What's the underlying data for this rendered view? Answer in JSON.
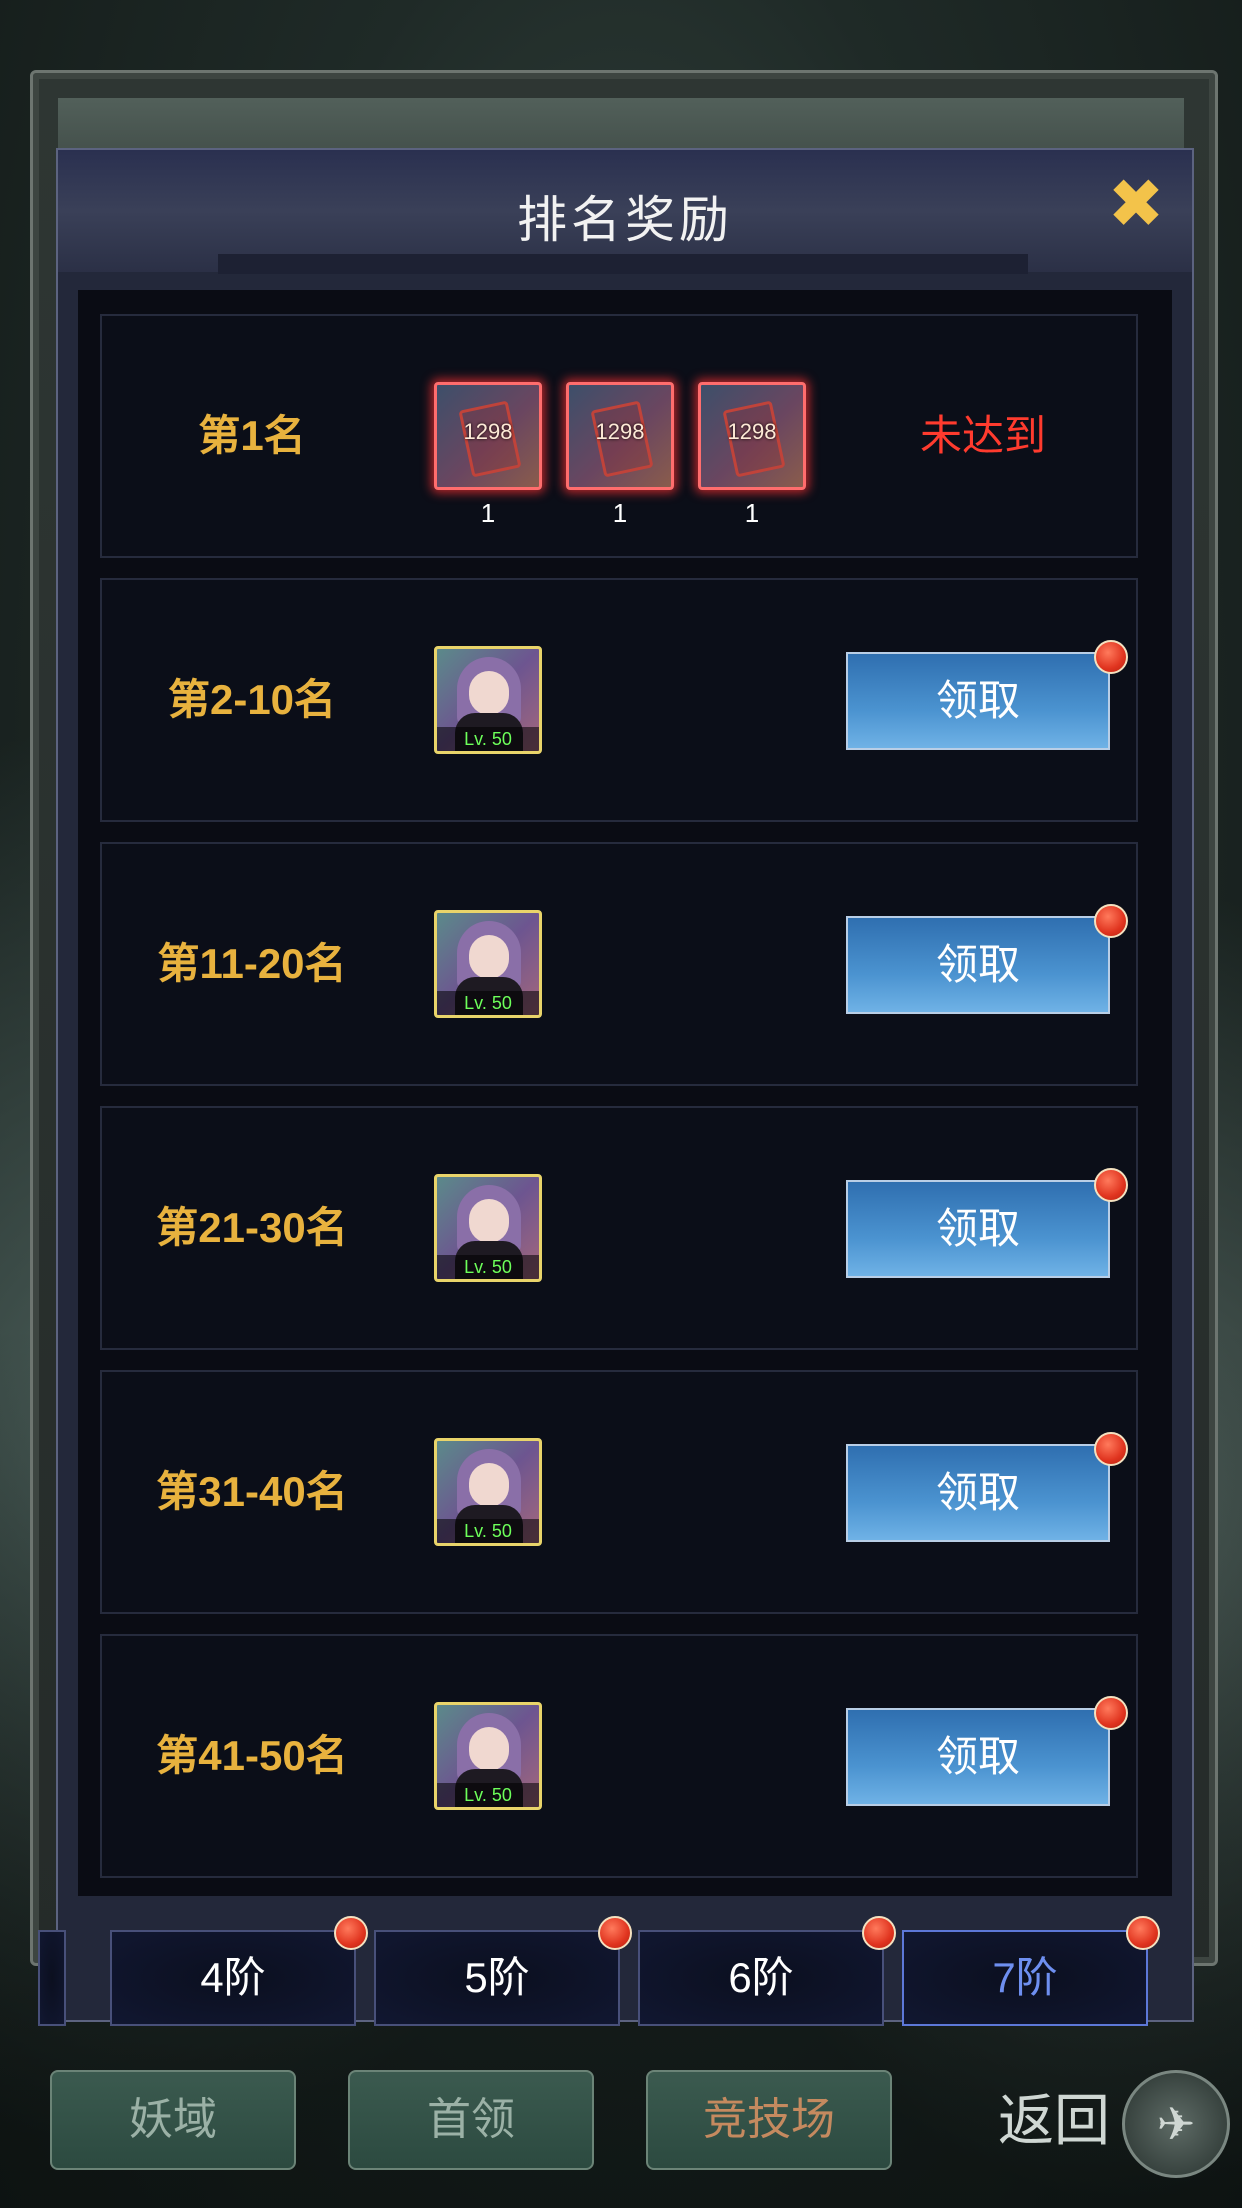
{
  "title": "排名奖励",
  "close_icon": "✖",
  "rows": [
    {
      "rank": "第1名",
      "items": [
        {
          "num": "1298",
          "qty": "1"
        },
        {
          "num": "1298",
          "qty": "1"
        },
        {
          "num": "1298",
          "qty": "1"
        }
      ],
      "status": "未达到"
    },
    {
      "rank": "第2-10名",
      "hero_level": "Lv. 50",
      "button": "领取"
    },
    {
      "rank": "第11-20名",
      "hero_level": "Lv. 50",
      "button": "领取"
    },
    {
      "rank": "第21-30名",
      "hero_level": "Lv. 50",
      "button": "领取"
    },
    {
      "rank": "第31-40名",
      "hero_level": "Lv. 50",
      "button": "领取"
    },
    {
      "rank": "第41-50名",
      "hero_level": "Lv. 50",
      "button": "领取"
    }
  ],
  "tiers": [
    "4阶",
    "5阶",
    "6阶",
    "7阶"
  ],
  "active_tier": "7阶",
  "bottom_nav": [
    "妖域",
    "首领",
    "竞技场"
  ],
  "back_label": "返回",
  "colors": {
    "rank_gold": "#e8b23e",
    "status_red": "#ff3b2e",
    "active_tier_blue": "#6e8ff0"
  }
}
